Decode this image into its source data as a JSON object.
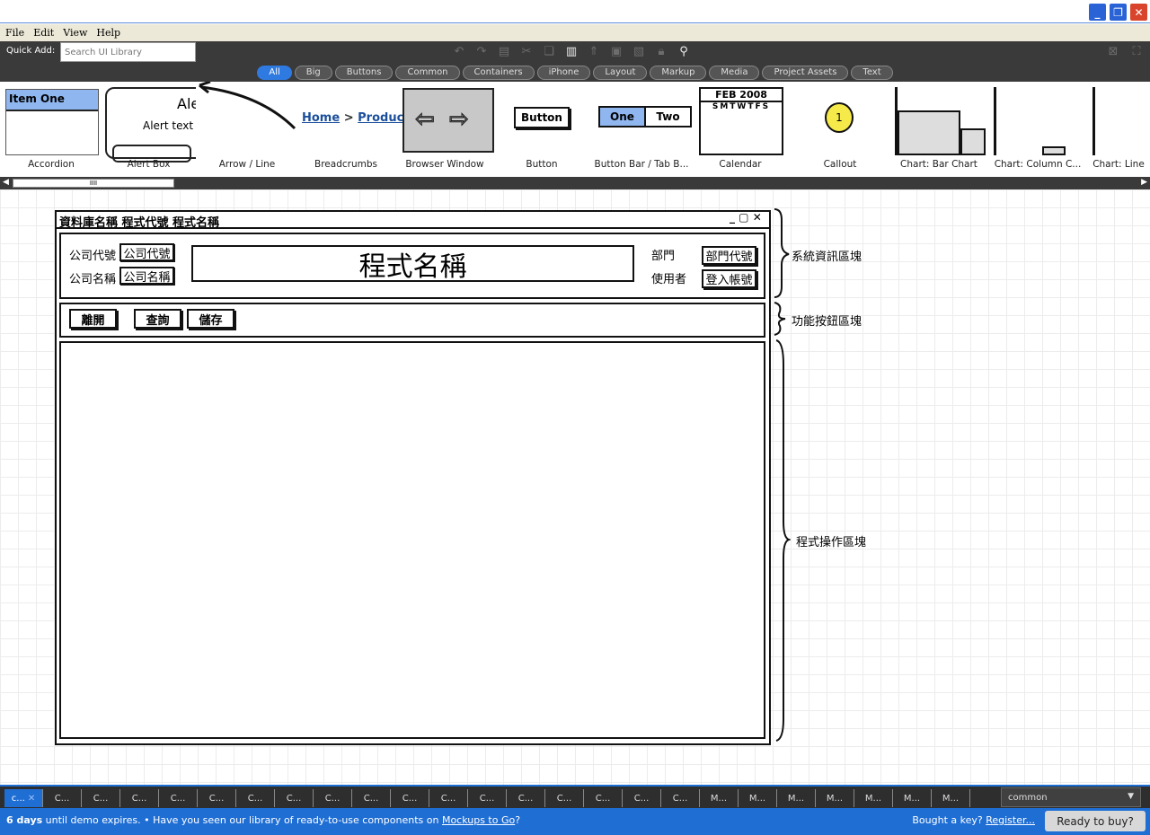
{
  "window": {
    "minimize_glyph": "_",
    "restore_glyph": "❐",
    "close_glyph": "✕"
  },
  "menu": [
    "File",
    "Edit",
    "View",
    "Help"
  ],
  "toolbar": {
    "quick_add_label": "Quick Add:",
    "search_placeholder": "Search UI Library"
  },
  "filters": [
    "All",
    "Big",
    "Buttons",
    "Common",
    "Containers",
    "iPhone",
    "Layout",
    "Markup",
    "Media",
    "Project Assets",
    "Text"
  ],
  "library": {
    "items": [
      "Accordion",
      "Alert Box",
      "Arrow / Line",
      "Breadcrumbs",
      "Browser Window",
      "Button",
      "Button Bar / Tab B...",
      "Calendar",
      "Callout",
      "Chart: Bar Chart",
      "Chart: Column C...",
      "Chart: Line"
    ],
    "accordion_item": "Item One",
    "alert_title": "Ale",
    "alert_text": "Alert text g",
    "breadcrumb_home": "Home",
    "breadcrumb_sep": ">",
    "breadcrumb_product": "Produc",
    "button_text": "Button",
    "buttonbar_one": "One",
    "buttonbar_two": "Two",
    "calendar_month": "FEB 2008",
    "calendar_days": "SMTWTFS",
    "callout_number": "1"
  },
  "scrollbar": {
    "thumb_label": "IIII"
  },
  "mockup": {
    "window_title": "資料庫名稱 程式代號 程式名稱",
    "window_controls": "_ ▢ ✕",
    "company_code_label": "公司代號",
    "company_code_value": "公司代號",
    "company_name_label": "公司名稱",
    "company_name_value": "公司名稱",
    "program_name": "程式名稱",
    "dept_label": "部門",
    "dept_value": "部門代號",
    "user_label": "使用者",
    "user_value": "登入帳號",
    "buttons": [
      "離開",
      "查詢",
      "儲存"
    ]
  },
  "annotations": {
    "system_info": "系統資訊區塊",
    "function_buttons": "功能按鈕區塊",
    "operation_area": "程式操作區塊"
  },
  "tabs": [
    "c...",
    "C...",
    "C...",
    "C...",
    "C...",
    "C...",
    "C...",
    "C...",
    "C...",
    "C...",
    "C...",
    "C...",
    "C...",
    "C...",
    "C...",
    "C...",
    "C...",
    "C...",
    "M...",
    "M...",
    "M...",
    "M...",
    "M...",
    "M...",
    "M..."
  ],
  "tab_close_glyph": "✕",
  "project_select": "common",
  "status": {
    "days": "6 days",
    "message": "until demo expires. • Have you seen our library of ready-to-use components on",
    "link": "Mockups to Go",
    "question": "?",
    "bought_prefix": "Bought a key?",
    "register": "Register...",
    "buy_button": "Ready to buy?"
  }
}
